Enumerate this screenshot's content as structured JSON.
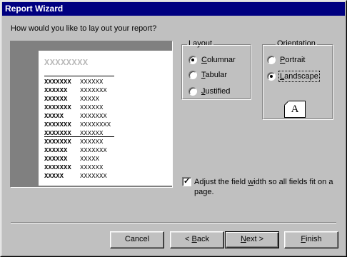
{
  "window": {
    "title": "Report Wizard"
  },
  "question": "How would you like to lay out your report?",
  "preview": {
    "title": "XXXXXXXX",
    "rows": [
      {
        "label": "XXXXXXX",
        "value": "XXXXXX"
      },
      {
        "label": "XXXXXX",
        "value": "XXXXXXX"
      },
      {
        "label": "XXXXXX",
        "value": "XXXXX"
      },
      {
        "label": "XXXXXXX",
        "value": "XXXXXX"
      },
      {
        "label": "XXXXX",
        "value": "XXXXXXX"
      },
      {
        "label": "XXXXXXX",
        "value": "XXXXXXXX"
      },
      {
        "label": "XXXXXXX",
        "value": "XXXXXX"
      },
      {
        "label": "XXXXXXX",
        "value": "XXXXXX"
      },
      {
        "label": "XXXXXX",
        "value": "XXXXXXX"
      },
      {
        "label": "XXXXXX",
        "value": "XXXXX"
      },
      {
        "label": "XXXXXXX",
        "value": "XXXXXX"
      },
      {
        "label": "XXXXX",
        "value": "XXXXXXX"
      }
    ]
  },
  "layout": {
    "legend": "Layout",
    "options": [
      {
        "pre": "",
        "key": "C",
        "post": "olumnar",
        "selected": true
      },
      {
        "pre": "",
        "key": "T",
        "post": "abular",
        "selected": false
      },
      {
        "pre": "",
        "key": "J",
        "post": "ustified",
        "selected": false
      }
    ]
  },
  "orientation": {
    "legend": "Orientation",
    "options": [
      {
        "pre": "",
        "key": "P",
        "post": "ortrait",
        "selected": false
      },
      {
        "pre": "",
        "key": "L",
        "post": "andscape",
        "selected": true
      }
    ],
    "icon_letter": "A"
  },
  "adjust": {
    "checked": true,
    "label_pre": "Adjust the field ",
    "label_key": "w",
    "label_post": "idth so all fields fit on a page."
  },
  "buttons": {
    "cancel": {
      "pre": "Cancel",
      "key": "",
      "post": ""
    },
    "back": {
      "pre": "< ",
      "key": "B",
      "post": "ack"
    },
    "next": {
      "pre": "",
      "key": "N",
      "post": "ext >"
    },
    "finish": {
      "pre": "",
      "key": "F",
      "post": "inish"
    }
  }
}
